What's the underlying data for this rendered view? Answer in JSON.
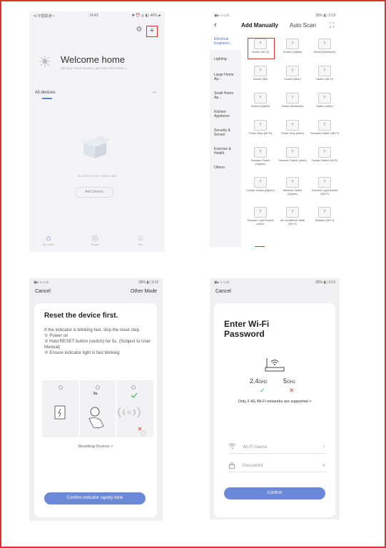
{
  "screen1": {
    "status_left": "•ıl 中国联通 ≈",
    "status_center": "14:43",
    "status_right": "✱ ⏰ ◎ ▮▯ 46% ■",
    "plus_icon": "+",
    "gear_icon": "⚙",
    "welcome": "Welcome home",
    "welcome_sub": "Set your home location, get more information >",
    "all_devices": "All devices",
    "more": "•••",
    "empty_text": "No devices yet, please add",
    "add_button": "Add Device",
    "nav": [
      {
        "label": "My Home",
        "icon": "⌂"
      },
      {
        "label": "Smart",
        "icon": "◎"
      },
      {
        "label": "Me",
        "icon": "☺"
      }
    ]
  },
  "screen2": {
    "status_left": "▣▸ ᵗᵢₗ ᵗᵢₗ ⊙",
    "status_right": "28% ▮▯ 3:19",
    "back": "‹",
    "tab_add": "Add Manually",
    "tab_scan": "Auto Scan",
    "scan_icon": "⛶",
    "categories": [
      "Electrical Engineeri...",
      "Lighting",
      "Large Home Ap...",
      "Small Home Ap...",
      "Kitchen Appliance",
      "Security & Sensor",
      "Exercise & Health",
      "Others"
    ],
    "devices": [
      "Socket (Wi-Fi)",
      "Socket (Zigbee)",
      "Socket (Bluetooth)",
      "Socket (NB)",
      "Socket (other)",
      "Switch (Wi-Fi)",
      "Switch (Zigbee)",
      "Switch (Bluetooth)",
      "Switch (other)",
      "Power Strip (Wi-Fi)",
      "Power Strip (other)",
      "Scenario Switch (Wi-Fi)",
      "Scenario Switch (Zigbee)",
      "Scenario Switch (other)",
      "Curtain Switch (Wi-Fi)",
      "Curtain Switch (Zigbee)",
      "Wireless Switch (Zigbee)",
      "Scenario Light Socket (Wi-Fi)",
      "Scenario Light Socket (other)",
      "Air Conditioner Mate (Wi-Fi)",
      "Breaker (Wi-Fi)"
    ]
  },
  "screen3": {
    "status_left": "▣▸ ᵗᵢₗ ᵗᵢₗ ⊙",
    "status_right": "28% ▮▯ 3:19",
    "cancel": "Cancel",
    "other_mode": "Other Mode",
    "title": "Reset the device first.",
    "intro": "If the indicator is blinking fast, skip the reset step",
    "steps": [
      "① Power on",
      "② Hold RESET button (switch) for 5s. (Subject to User Manual)",
      "③ Ensure indicator light is fast blinking"
    ],
    "illu_5s": "5s",
    "resetting": "Resetting Devices >",
    "confirm": "Confirm indicator rapidly blink"
  },
  "screen4": {
    "status_left": "▣▸ ᵗᵢₗ ᵗᵢₗ ⊙",
    "status_right": "28% ▮▯ 3:19",
    "cancel": "Cancel",
    "title": "Enter Wi-Fi Password",
    "band1": "2.4",
    "band1_unit": "GHz",
    "band2": "5",
    "band2_unit": "GHz",
    "ok_mark": "✓",
    "no_mark": "✕",
    "only": "Only 2.4G Wi-Fi networks are supported >",
    "wifi_placeholder": "Wi-Fi Name",
    "wifi_right": "⇅",
    "password_placeholder": "Password",
    "password_right": "◉",
    "confirm": "Confirm"
  }
}
